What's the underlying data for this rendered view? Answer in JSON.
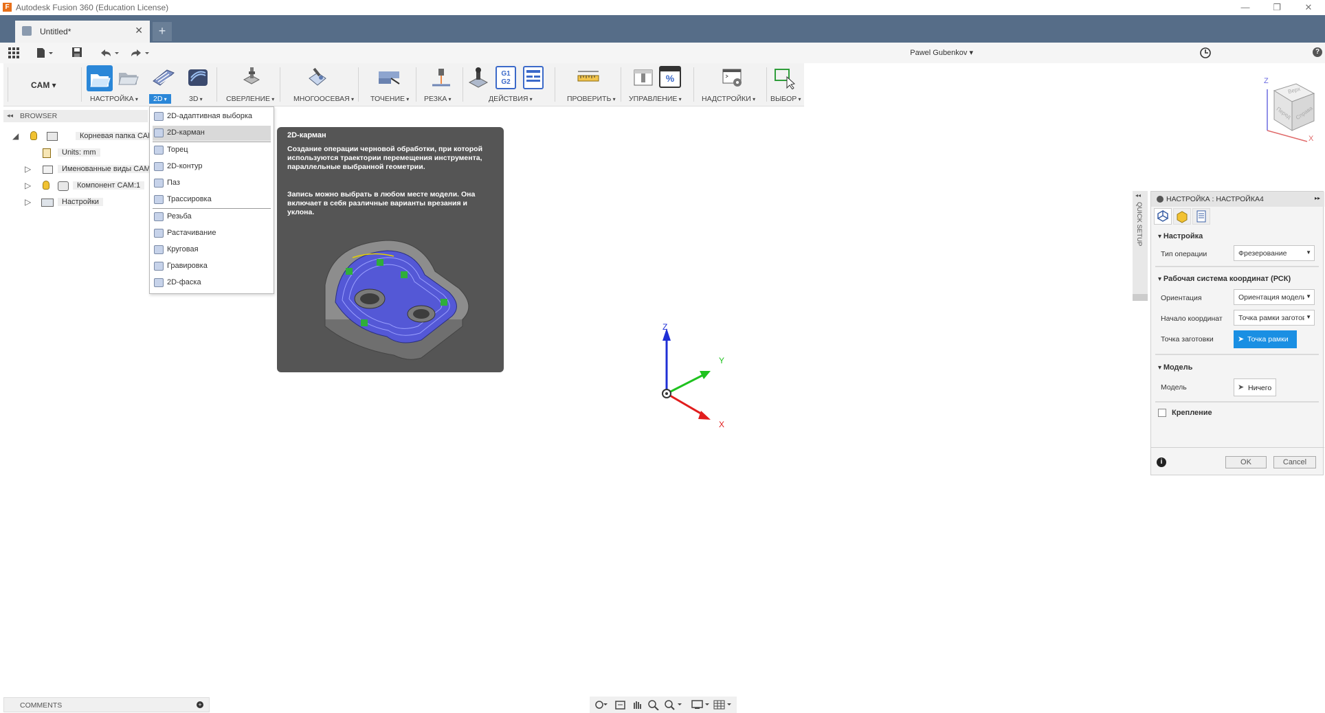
{
  "window": {
    "title": "Autodesk Fusion 360 (Education License)",
    "logo_letter": "F",
    "minimize_icon": "—",
    "restore_icon": "❐",
    "close_icon": "✕"
  },
  "tabs": {
    "document_title": "Untitled*",
    "close_glyph": "✕",
    "new_tab_glyph": "+"
  },
  "quick_access": {
    "user": "Pawel Gubenkov ▾",
    "help": "?"
  },
  "toolbar": {
    "workspace": "CAM ▾",
    "groups": [
      {
        "label": "НАСТРОЙКА"
      },
      {
        "label": "2D"
      },
      {
        "label": "3D"
      },
      {
        "label": "СВЕРЛЕНИЕ"
      },
      {
        "label": "МНОГООСЕВАЯ"
      },
      {
        "label": "ТОЧЕНИЕ"
      },
      {
        "label": "РЕЗКА"
      },
      {
        "label": "ДЕЙСТВИЯ"
      },
      {
        "label": "ПРОВЕРИТЬ"
      },
      {
        "label": "УПРАВЛЕНИЕ"
      },
      {
        "label": "НАДСТРОЙКИ"
      },
      {
        "label": "ВЫБОР"
      }
    ],
    "gcode_icon_text": "G1\nG2",
    "percent_icon_text": "%"
  },
  "browser": {
    "title": "BROWSER",
    "items": [
      {
        "label": "Корневая папка CAM"
      },
      {
        "label": "Units: mm"
      },
      {
        "label": "Именованные виды CAM"
      },
      {
        "label": "Компонент CAM:1"
      },
      {
        "label": "Настройки"
      }
    ]
  },
  "menu_2d": {
    "items": [
      "2D-адаптивная выборка",
      "2D-карман",
      "Торец",
      "2D-контур",
      "Паз",
      "Трассировка",
      "Резьба",
      "Растачивание",
      "Круговая",
      "Гравировка",
      "2D-фаска"
    ],
    "selected_index": 1
  },
  "tooltip": {
    "title": "2D-карман",
    "paragraph1": "Создание операции черновой обработки, при которой используются траектории перемещения инструмента, параллельные выбранной геометрии.",
    "paragraph2": "Запись можно выбрать в любом месте модели. Она включает в себя различные варианты врезания и уклона."
  },
  "triad": {
    "x": "X",
    "y": "Y",
    "z": "Z"
  },
  "viewcube": {
    "z": "Z",
    "x": "X",
    "top": "Верх",
    "front": "Перед",
    "right": "Справа"
  },
  "setup_panel": {
    "header": "НАСТРОЙКА : НАСТРОЙКА4",
    "quick_setup": "QUICK SETUP",
    "section_setup": "Настройка",
    "op_type_label": "Тип операции",
    "op_type_value": "Фрезерование",
    "section_wcs": "Рабочая система координат (РСК)",
    "orientation_label": "Ориентация",
    "orientation_value": "Ориентация модели",
    "origin_label": "Начало координат",
    "origin_value": "Точка рамки заготовки",
    "stock_point_label": "Точка заготовки",
    "stock_point_button": "Точка рамки",
    "section_model": "Модель",
    "model_label": "Модель",
    "model_button": "Ничего",
    "fixture_label": "Крепление",
    "ok": "OK",
    "cancel": "Cancel",
    "info_glyph": "i",
    "expand_glyph": "▸▸",
    "collapse_glyph": "◂◂"
  },
  "comments": {
    "label": "COMMENTS"
  },
  "colors": {
    "tabbar": "#566d88",
    "active_tool": "#2b87d8",
    "primary_button": "#1a8fe3",
    "tooltip_bg": "#555555"
  }
}
